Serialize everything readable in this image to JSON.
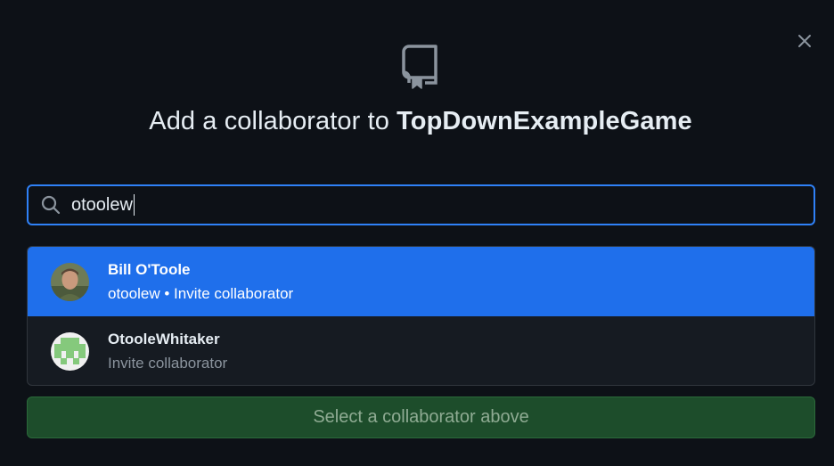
{
  "dialog": {
    "title_prefix": "Add a collaborator to",
    "repo_name": "TopDownExampleGame",
    "repo_icon": "repo-icon",
    "close_icon": "close-icon"
  },
  "search": {
    "value": "otoolew",
    "icon": "search-icon"
  },
  "results": [
    {
      "name": "Bill O'Toole",
      "login": "otoolew",
      "separator": "•",
      "action": "Invite collaborator",
      "selected": true
    },
    {
      "name": "OtooleWhitaker",
      "action": "Invite collaborator",
      "selected": false
    }
  ],
  "submit": {
    "label": "Select a collaborator above",
    "disabled": true
  },
  "colors": {
    "background": "#0d1117",
    "accent": "#1f6feb",
    "focus_border": "#2f81f7",
    "button_disabled": "#1d4d2b"
  }
}
